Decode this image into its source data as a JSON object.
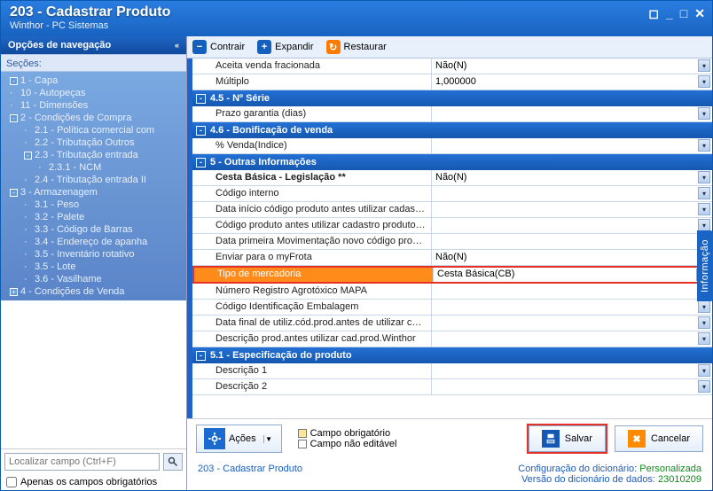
{
  "title": "203 - Cadastrar  Produto",
  "subtitle": "Winthor - PC Sistemas",
  "nav": {
    "header": "Opções de navegação",
    "sections_label": "Seções:",
    "items": [
      {
        "lvl": 1,
        "exp": "-",
        "label": "1 - Capa"
      },
      {
        "lvl": 1,
        "exp": "",
        "label": "10 - Autopeças"
      },
      {
        "lvl": 1,
        "exp": "",
        "label": "11 - Dimensões"
      },
      {
        "lvl": 1,
        "exp": "-",
        "label": "2 - Condições de Compra"
      },
      {
        "lvl": 2,
        "exp": "",
        "label": "2.1 - Política comercial com"
      },
      {
        "lvl": 2,
        "exp": "",
        "label": "2.2 - Tributação Outros"
      },
      {
        "lvl": 2,
        "exp": "-",
        "label": "2.3 - Tributação entrada"
      },
      {
        "lvl": 3,
        "exp": "",
        "label": "2.3.1 - NCM"
      },
      {
        "lvl": 2,
        "exp": "",
        "label": "2.4 - Tributação entrada II"
      },
      {
        "lvl": 1,
        "exp": "-",
        "label": "3 - Armazenagem"
      },
      {
        "lvl": 2,
        "exp": "",
        "label": "3.1 - Peso"
      },
      {
        "lvl": 2,
        "exp": "",
        "label": "3.2 - Palete"
      },
      {
        "lvl": 2,
        "exp": "",
        "label": "3.3 - Código de Barras"
      },
      {
        "lvl": 2,
        "exp": "",
        "label": "3.4 - Endereço de apanha"
      },
      {
        "lvl": 2,
        "exp": "",
        "label": "3.5 - Inventário rotativo"
      },
      {
        "lvl": 2,
        "exp": "",
        "label": "3.5 - Lote"
      },
      {
        "lvl": 2,
        "exp": "",
        "label": "3.6 - Vasilhame"
      },
      {
        "lvl": 1,
        "exp": "+",
        "label": "4 - Condições de Venda"
      }
    ],
    "search_placeholder": "Localizar campo (Ctrl+F)",
    "only_required": "Apenas os campos obrigatórios"
  },
  "toolbar": {
    "contract": "Contrair",
    "expand": "Expandir",
    "restore": "Restaurar"
  },
  "rows": [
    {
      "type": "row",
      "label": "Aceita venda fracionada",
      "value": "Não(N)",
      "dd": true
    },
    {
      "type": "row",
      "label": "Múltiplo",
      "value": "1,000000",
      "dd": true
    },
    {
      "type": "sec",
      "label": "4.5 - Nº Série"
    },
    {
      "type": "row",
      "label": "Prazo garantia (dias)",
      "value": "",
      "dd": true
    },
    {
      "type": "sec",
      "label": "4.6 - Bonificação de venda"
    },
    {
      "type": "row",
      "label": "% Venda(Indice)",
      "value": "",
      "dd": true
    },
    {
      "type": "sec",
      "label": "5 - Outras Informações"
    },
    {
      "type": "row",
      "label": "Cesta Básica - Legislação **",
      "value": "Não(N)",
      "dd": true,
      "bold": true
    },
    {
      "type": "row",
      "label": "Código interno",
      "value": "",
      "dd": true
    },
    {
      "type": "row",
      "label": "Data início código produto antes utilizar cadastro proc",
      "value": "",
      "dd": true
    },
    {
      "type": "row",
      "label": "Código produto antes utilizar cadastro produto Winth",
      "value": "",
      "dd": true
    },
    {
      "type": "row",
      "label": "Data primeira Movimentação novo código produto Wir",
      "value": "",
      "dd": true
    },
    {
      "type": "row",
      "label": "Enviar para o myFrota",
      "value": "Não(N)",
      "dd": true
    },
    {
      "type": "row",
      "label": "Tipo de mercadoria",
      "value": "Cesta Básica(CB)",
      "dd": true,
      "hl": true
    },
    {
      "type": "row",
      "label": "Número Registro Agrotóxico MAPA",
      "value": "",
      "dd": true
    },
    {
      "type": "row",
      "label": "Código Identificação Embalagem",
      "value": "",
      "dd": true
    },
    {
      "type": "row",
      "label": "Data final de utiliz.cód.prod.antes de utilizar cad.proc",
      "value": "",
      "dd": true
    },
    {
      "type": "row",
      "label": "Descrição prod.antes utilizar cad.prod.Winthor",
      "value": "",
      "dd": true
    },
    {
      "type": "sec",
      "label": "5.1 - Especificação do produto"
    },
    {
      "type": "row",
      "label": "Descrição 1",
      "value": "",
      "dd": true
    },
    {
      "type": "row",
      "label": "Descrição 2",
      "value": "",
      "dd": true
    }
  ],
  "info_tab": "Informação",
  "footer": {
    "actions": "Ações",
    "legend_required": "Campo obrigatório",
    "legend_readonly": "Campo não editável",
    "save": "Salvar",
    "cancel": "Cancelar"
  },
  "status": {
    "left": "203 - Cadastrar  Produto",
    "cfg_label": "Configuração do dicionário: ",
    "cfg_value": "Personalizada",
    "ver_label": "Versão do dicionário de dados: ",
    "ver_value": "23010209"
  }
}
